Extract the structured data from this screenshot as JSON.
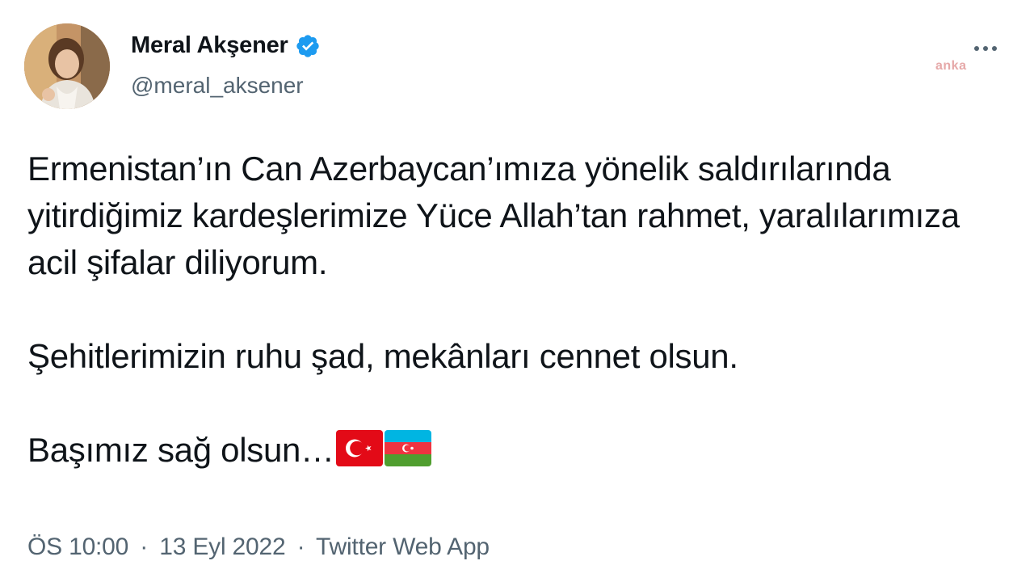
{
  "author": {
    "display_name": "Meral Akşener",
    "handle": "@meral_aksener",
    "verified": true
  },
  "watermark": "anka",
  "tweet": {
    "paragraphs": [
      "Ermenistan’ın Can Azerbaycan’ımıza yönelik saldırılarında yitirdiğimiz kardeşlerimize Yüce Allah’tan rahmet, yaralılarımıza acil şifalar diliyorum.",
      "Şehitlerimizin ruhu şad, mekânları cennet olsun.",
      "Başımız sağ olsun…"
    ],
    "emoji": [
      "turkey-flag",
      "azerbaijan-flag"
    ]
  },
  "meta": {
    "time": "ÖS 10:00",
    "date": "13 Eyl 2022",
    "source": "Twitter Web App",
    "separator": "·"
  },
  "colors": {
    "text": "#0f1419",
    "secondary": "#536471",
    "verified": "#1d9bf0"
  }
}
